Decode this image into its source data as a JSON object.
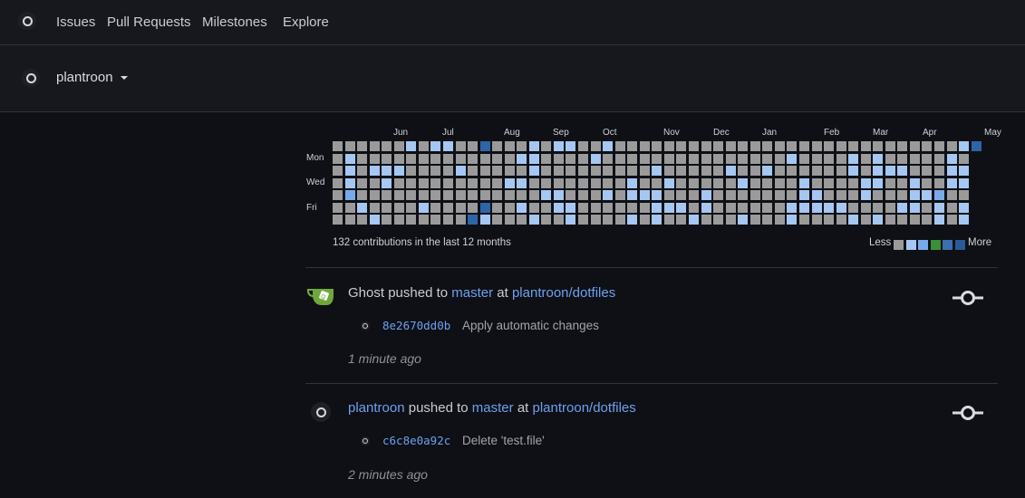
{
  "nav": {
    "logo": "app-logo-icon",
    "items": [
      "Issues",
      "Pull Requests",
      "Milestones",
      "Explore"
    ]
  },
  "user": {
    "name": "plantroon",
    "avatar": "user-avatar-icon"
  },
  "heatmap": {
    "months": [
      "Jun",
      "Jul",
      "Aug",
      "Sep",
      "Oct",
      "Nov",
      "Dec",
      "Jan",
      "Feb",
      "Mar",
      "Apr",
      "May"
    ],
    "days": [
      "Mon",
      "Wed",
      "Fri"
    ],
    "summary": "132 contributions in the last 12 months",
    "legend_less": "Less",
    "legend_more": "More",
    "legend_colors": [
      "#9a9a9a",
      "#a5c7f2",
      "#77aaea",
      "#3b8f3b",
      "#3a6fb0",
      "#275a98"
    ],
    "levels": {
      "0": "#9a9a9a",
      "1": "#a5c7f2",
      "2": "#77aaea",
      "3": "#2e65a8"
    }
  },
  "feed": [
    {
      "actor": "Ghost",
      "action": "pushed to",
      "branch": "master",
      "at": "at",
      "repo": "plantroon/dotfiles",
      "commit_sha": "8e2670dd0b",
      "commit_message": "Apply automatic changes",
      "time": "1 minute ago",
      "icon": "git-commit-icon"
    },
    {
      "actor": "plantroon",
      "action": "pushed to",
      "branch": "master",
      "at": "at",
      "repo": "plantroon/dotfiles",
      "commit_sha": "c6c8e0a92c",
      "commit_message": "Delete 'test.file'",
      "time": "2 minutes ago",
      "icon": "git-commit-icon"
    }
  ]
}
